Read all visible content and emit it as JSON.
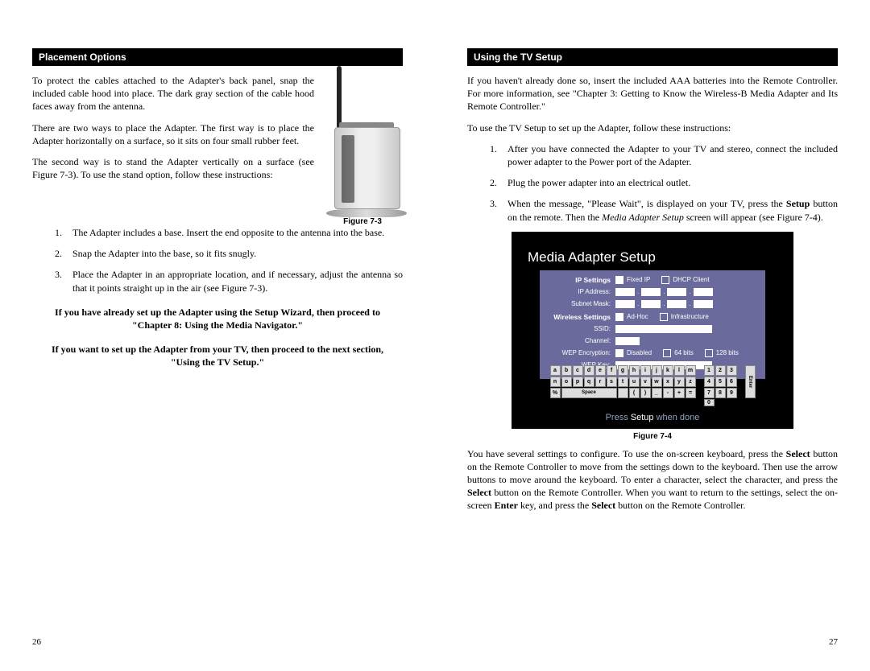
{
  "left": {
    "header": "Placement Options",
    "p1": "To protect the cables attached to the Adapter's back panel, snap the included cable hood into place. The dark gray section of the cable hood faces away from the antenna.",
    "p2": "There are two ways to place the Adapter. The first way is to place the Adapter horizontally on a surface, so it sits on four small rubber feet.",
    "p3": "The second way is to stand the Adapter vertically on a surface (see Figure 7-3). To use the stand option, follow these instructions:",
    "fig3_caption": "Figure 7-3",
    "list": [
      "The Adapter includes a base. Insert the end opposite to the antenna into the base.",
      "Snap the Adapter into the base, so it fits snugly.",
      "Place the Adapter in an appropriate location, and if necessary, adjust the antenna so that it points straight up in the air (see Figure 7-3)."
    ],
    "note1a": "If you have already set up the Adapter using the Setup Wizard, then proceed to \"Chapter 8: Using the Media Navigator.\"",
    "note2a": "If you want to set up the Adapter from your TV, then proceed to the next section, \"Using the TV Setup.\"",
    "pagenum": "26"
  },
  "right": {
    "header": "Using the TV Setup",
    "p1": "If you haven't already done so, insert the included AAA batteries into the Remote Controller. For more information, see \"Chapter 3: Getting to Know the Wireless-B Media Adapter and Its Remote Controller.\"",
    "p2": "To use the TV Setup to set up the Adapter, follow these instructions:",
    "list": [
      "After you have connected the Adapter to your TV and stereo, connect the included power adapter to the Power port of the Adapter.",
      "Plug the power adapter into an electrical outlet.",
      "When the message, \"Please Wait\", is displayed on your TV, press the Setup button on the remote. Then the Media Adapter Setup screen will appear (see Figure 7-4)."
    ],
    "setup3_bold1": "Setup",
    "setup3_italic": "Media Adapter Setup",
    "fig4_caption": "Figure 7-4",
    "tv_title": "Media Adapter Setup",
    "ip_settings_label": "IP Settings",
    "fixed_ip": "Fixed IP",
    "dhcp_client": "DHCP Client",
    "ip_address": "IP Address:",
    "subnet_mask": "Subnet Mask:",
    "wireless_settings_label": "Wireless Settings",
    "adhoc": "Ad-Hoc",
    "infrastructure": "Infrastructure",
    "ssid": "SSID:",
    "channel": "Channel:",
    "wep_encryption": "WEP Encryption:",
    "disabled": "Disabled",
    "b64": "64 bits",
    "b128": "128 bits",
    "wep_key": "WEP Key:",
    "press_setup_1": "Press",
    "press_setup_2": "Setup",
    "press_setup_3": "when done",
    "kb_row1": [
      "a",
      "b",
      "c",
      "d",
      "e",
      "f",
      "g",
      "h",
      "i",
      "j",
      "k",
      "l",
      "m"
    ],
    "kb_row2": [
      "n",
      "o",
      "p",
      "q",
      "r",
      "s",
      "t",
      "u",
      "v",
      "w",
      "x",
      "y",
      "z"
    ],
    "kb_row3": [
      "%",
      "",
      "",
      "",
      "",
      "",
      "",
      "(",
      ")",
      "_",
      "-",
      "+",
      "="
    ],
    "kb_space": "Space",
    "kb_num": [
      "1",
      "2",
      "3",
      "4",
      "5",
      "6",
      "7",
      "8",
      "9",
      "0"
    ],
    "kb_enter": "Enter",
    "p3_1": "You have several settings to configure. To use the on-screen keyboard, press the ",
    "p3_b1": "Select",
    "p3_2": " button on the Remote Controller to move from the settings down to the keyboard. Then use the arrow buttons to move around the keyboard. To enter a character, select the character, and press the ",
    "p3_b2": "Select",
    "p3_3": " button on the Remote Controller. When you want to return to the settings, select the on-screen ",
    "p3_b3": "Enter",
    "p3_4": " key, and press the ",
    "p3_b4": "Select",
    "p3_5": " button on the Remote Controller.",
    "pagenum": "27"
  }
}
